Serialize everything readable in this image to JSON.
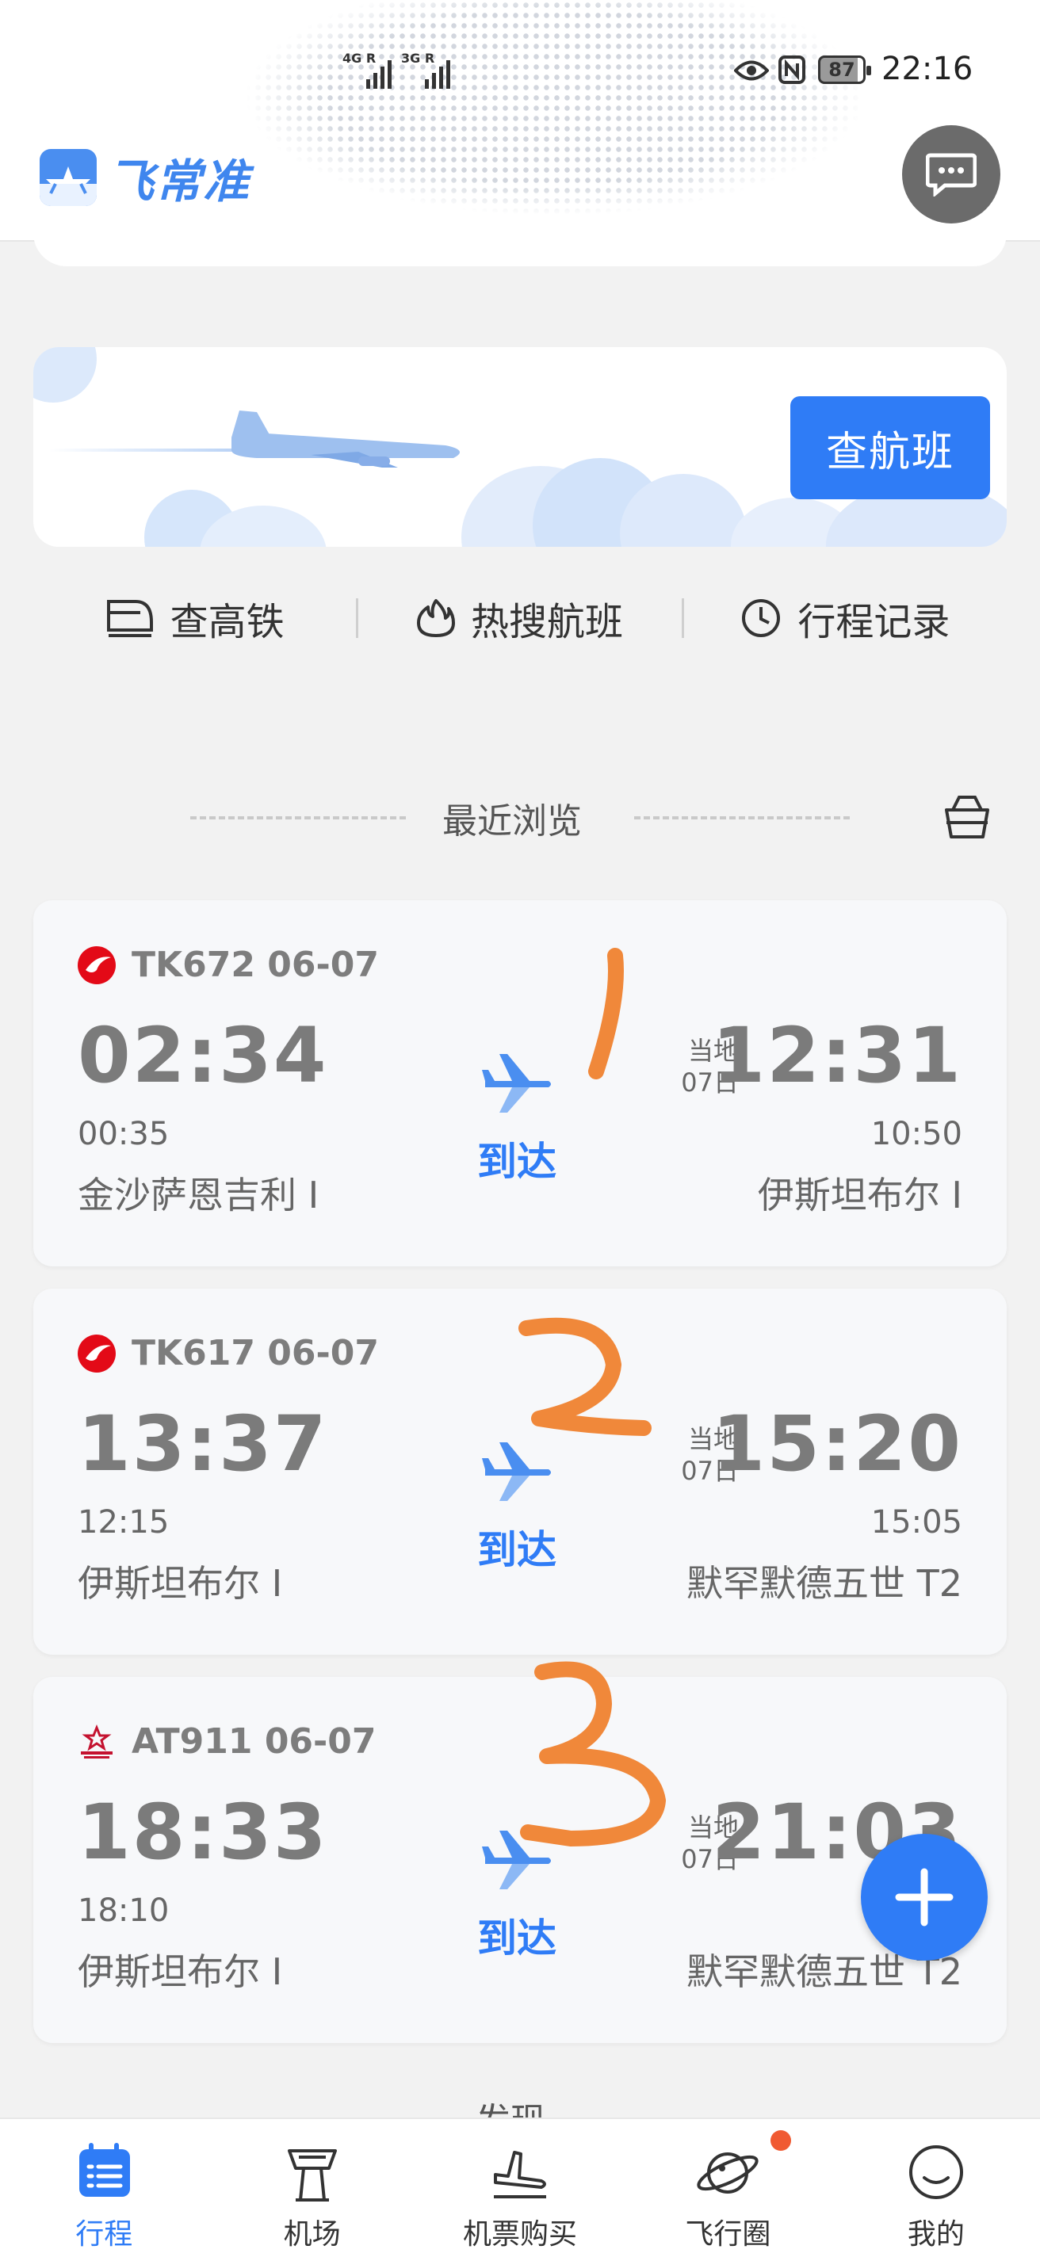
{
  "status_bar": {
    "sim1": "4G R",
    "sim2": "3G R",
    "battery": "87",
    "time": "22:16"
  },
  "app": {
    "name": "飞常准",
    "brand_color": "#3f86ee",
    "accent_color": "#2f7cf6"
  },
  "banner": {
    "check_flight_label": "查航班"
  },
  "quick_links": [
    {
      "label": "查高铁",
      "icon": "train-icon"
    },
    {
      "label": "热搜航班",
      "icon": "flame-icon"
    },
    {
      "label": "行程记录",
      "icon": "clock-icon"
    }
  ],
  "recent": {
    "title": "最近浏览"
  },
  "flights": [
    {
      "flight": "TK672 06-07",
      "airline_icon": "turkish-airlines-logo",
      "dep_time": "02:34",
      "dep_plan": "00:35",
      "dep_city": "金沙萨恩吉利 I",
      "status": "到达",
      "local_label": "当地",
      "local_date": "07日",
      "arr_time": "12:31",
      "arr_plan": "10:50",
      "arr_city": "伊斯坦布尔 I"
    },
    {
      "flight": "TK617 06-07",
      "airline_icon": "turkish-airlines-logo",
      "dep_time": "13:37",
      "dep_plan": "12:15",
      "dep_city": "伊斯坦布尔 I",
      "status": "到达",
      "local_label": "当地",
      "local_date": "07日",
      "arr_time": "15:20",
      "arr_plan": "15:05",
      "arr_city": "默罕默德五世 T2"
    },
    {
      "flight": "AT911 06-07",
      "airline_icon": "royal-air-maroc-logo",
      "dep_time": "18:33",
      "dep_plan": "18:10",
      "dep_city": "伊斯坦布尔 I",
      "status": "到达",
      "local_label": "当地",
      "local_date": "07日",
      "arr_time": "21:03",
      "arr_plan": "",
      "arr_city": "默罕默德五世 T2"
    }
  ],
  "next_section_title_partial": "发现",
  "tabbar": [
    {
      "label": "行程",
      "icon": "itinerary-icon",
      "active": true
    },
    {
      "label": "机场",
      "icon": "control-tower-icon"
    },
    {
      "label": "机票购买",
      "icon": "plane-landing-icon"
    },
    {
      "label": "飞行圈",
      "icon": "planet-icon",
      "badge": true
    },
    {
      "label": "我的",
      "icon": "smiley-icon"
    }
  ]
}
